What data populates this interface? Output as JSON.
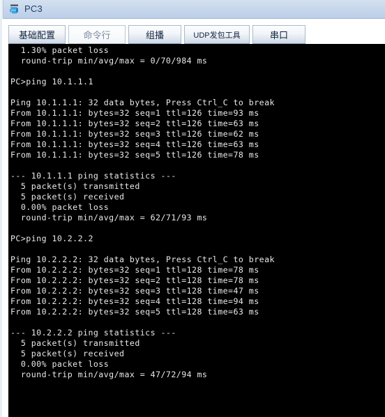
{
  "window": {
    "title": "PC3",
    "icon": "pc-device-icon",
    "accent_color": "#c6d6ea",
    "title_text_color": "#1f3f6e"
  },
  "tabs": [
    {
      "label": "基础配置",
      "name": "tab-basic-config",
      "selected": false
    },
    {
      "label": "命令行",
      "name": "tab-command-line",
      "selected": true
    },
    {
      "label": "组播",
      "name": "tab-multicast",
      "selected": false
    },
    {
      "label": "UDP发包工具",
      "name": "tab-udp-packet-tool",
      "selected": false
    },
    {
      "label": "串口",
      "name": "tab-serial-port",
      "selected": false
    }
  ],
  "terminal": {
    "background_color": "#000000",
    "text_color": "#e9e9e9",
    "prompt": "PC>",
    "lines": [
      "  1.30% packet loss",
      "  round-trip min/avg/max = 0/70/984 ms",
      "",
      "PC>ping 10.1.1.1",
      "",
      "Ping 10.1.1.1: 32 data bytes, Press Ctrl_C to break",
      "From 10.1.1.1: bytes=32 seq=1 ttl=126 time=93 ms",
      "From 10.1.1.1: bytes=32 seq=2 ttl=126 time=63 ms",
      "From 10.1.1.1: bytes=32 seq=3 ttl=126 time=62 ms",
      "From 10.1.1.1: bytes=32 seq=4 ttl=126 time=63 ms",
      "From 10.1.1.1: bytes=32 seq=5 ttl=126 time=78 ms",
      "",
      "--- 10.1.1.1 ping statistics ---",
      "  5 packet(s) transmitted",
      "  5 packet(s) received",
      "  0.00% packet loss",
      "  round-trip min/avg/max = 62/71/93 ms",
      "",
      "PC>ping 10.2.2.2",
      "",
      "Ping 10.2.2.2: 32 data bytes, Press Ctrl_C to break",
      "From 10.2.2.2: bytes=32 seq=1 ttl=128 time=78 ms",
      "From 10.2.2.2: bytes=32 seq=2 ttl=128 time=78 ms",
      "From 10.2.2.2: bytes=32 seq=3 ttl=128 time=47 ms",
      "From 10.2.2.2: bytes=32 seq=4 ttl=128 time=94 ms",
      "From 10.2.2.2: bytes=32 seq=5 ttl=128 time=63 ms",
      "",
      "--- 10.2.2.2 ping statistics ---",
      "  5 packet(s) transmitted",
      "  5 packet(s) received",
      "  0.00% packet loss",
      "  round-trip min/avg/max = 47/72/94 ms"
    ]
  }
}
